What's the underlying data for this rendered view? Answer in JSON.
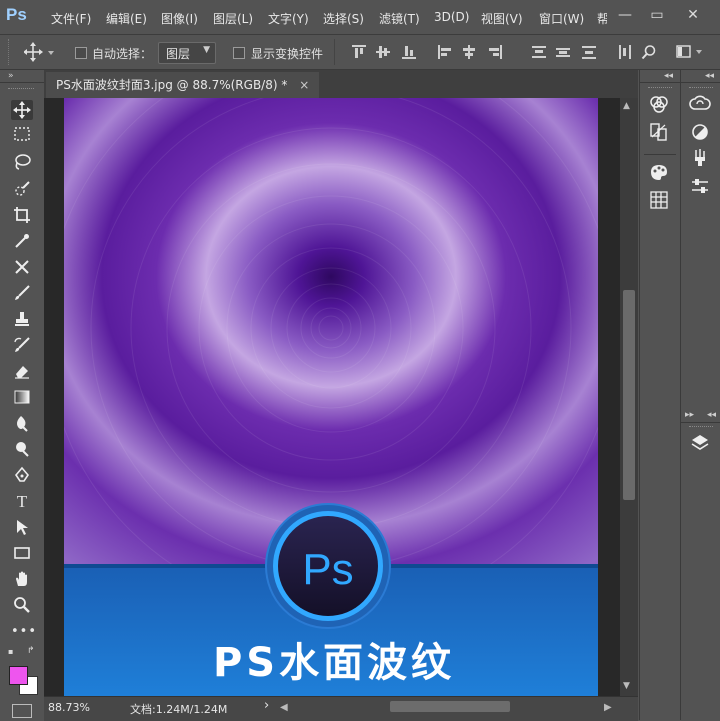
{
  "app": {
    "logo": "Ps"
  },
  "menu": [
    "文件(F)",
    "编辑(E)",
    "图像(I)",
    "图层(L)",
    "文字(Y)",
    "选择(S)",
    "滤镜(T)",
    "3D(D)",
    "视图(V)",
    "窗口(W)",
    "帮"
  ],
  "window_controls": {
    "minimize": "—",
    "restore": "▭",
    "close": "✕"
  },
  "options": {
    "auto_select_label": "自动选择：",
    "layer_select_value": "图层",
    "show_transform_label": "显示变换控件"
  },
  "document": {
    "tab_title": "PS水面波纹封面3.jpg @ 88.7%(RGB/8) *",
    "tab_close": "×"
  },
  "artwork": {
    "badge_text": "Ps",
    "title": "PS水面波纹",
    "colors": {
      "purple_dark": "#4a0f84",
      "purple_light": "#c8a8e4",
      "blue": "#1a73c8",
      "badge_bg": "#1e1a3a",
      "badge_accent": "#31a8ff"
    }
  },
  "status": {
    "zoom": "88.73%",
    "doc_info": "文档:1.24M/1.24M",
    "arrow": "›"
  },
  "colors": {
    "foreground": "#ee55ee",
    "background": "#ffffff"
  },
  "tools": [
    "move-icon",
    "marquee-icon",
    "lasso-icon",
    "quick-select-icon",
    "crop-icon",
    "eyedropper-icon",
    "healing-icon",
    "brush-icon",
    "stamp-icon",
    "history-brush-icon",
    "eraser-icon",
    "gradient-icon",
    "blur-icon",
    "dodge-icon",
    "pen-icon",
    "type-icon",
    "path-select-icon",
    "rectangle-icon",
    "hand-icon",
    "zoom-icon",
    "more-icon"
  ],
  "panels": [
    "color-icon",
    "swatches-icon",
    "adjust-icon",
    "libraries-icon",
    "cc-libraries-icon",
    "properties-icon",
    "brush-preset-icon",
    "adjustments-icon",
    "layers-icon"
  ]
}
